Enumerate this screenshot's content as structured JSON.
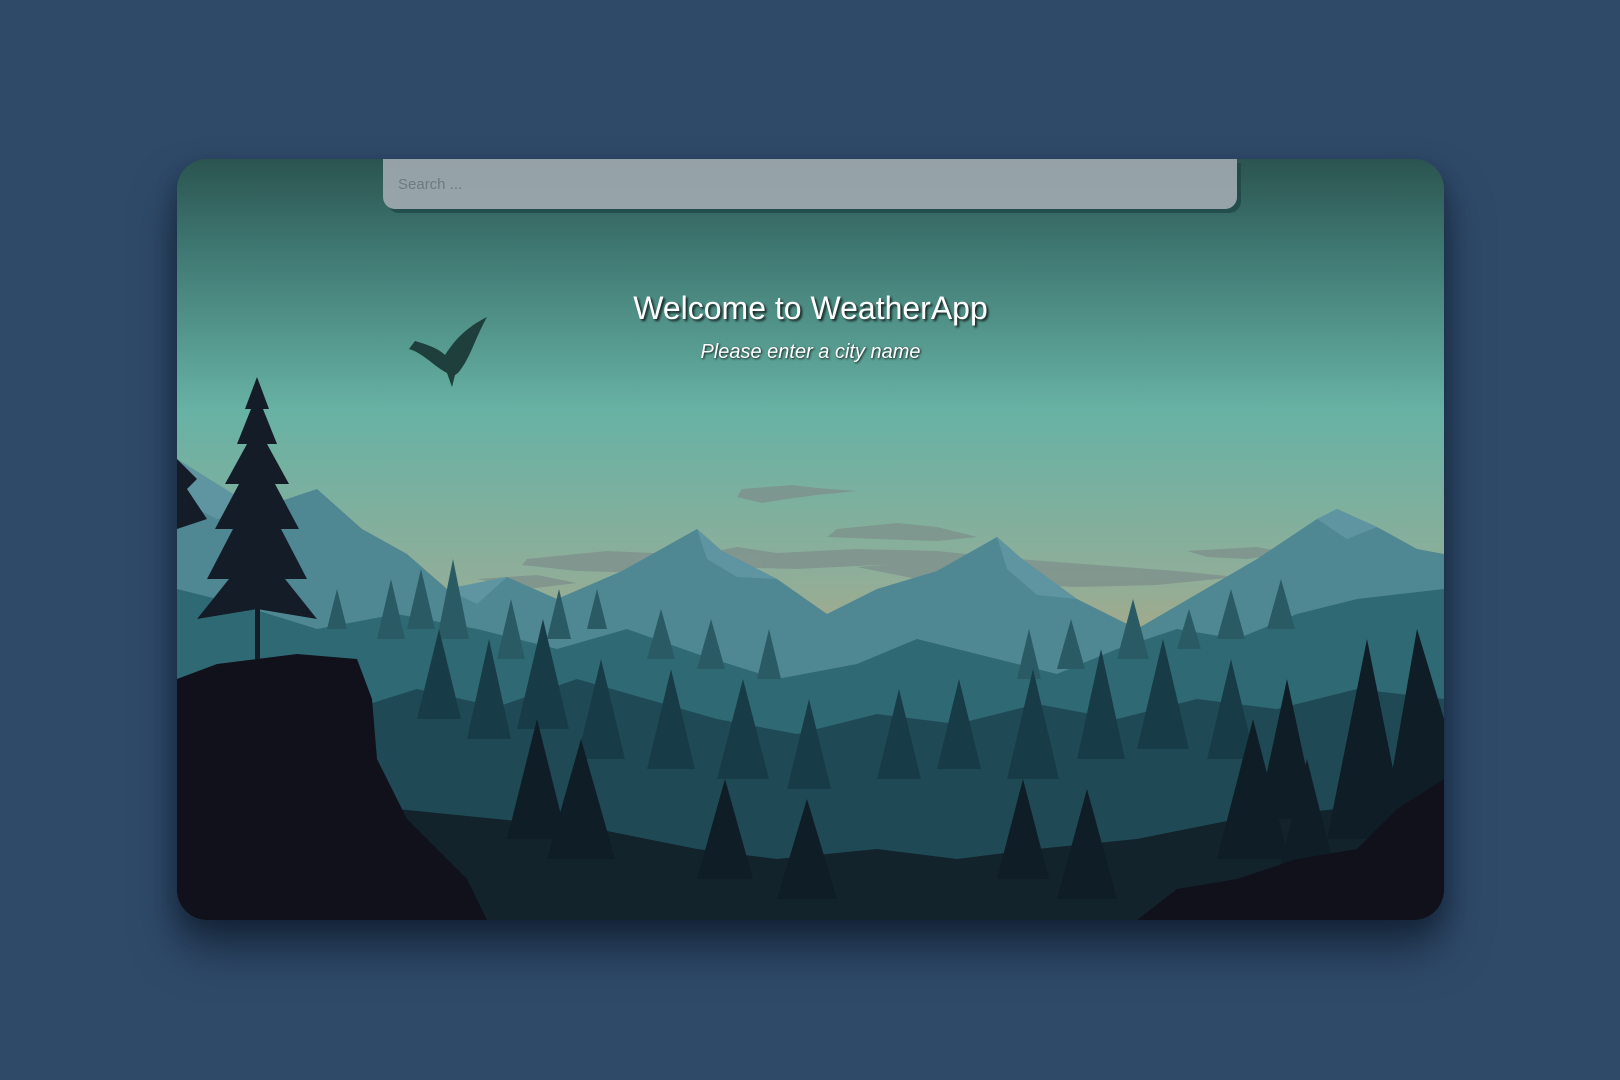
{
  "app": {
    "name": "WeatherApp"
  },
  "search": {
    "placeholder": "Search ...",
    "value": ""
  },
  "welcome": {
    "title": "Welcome to WeatherApp",
    "subtitle": "Please enter a city name"
  },
  "background": {
    "scene": "mountain-forest-landscape",
    "bird_icon": "eagle-icon",
    "colors": {
      "page": "#2f4a69",
      "sky_top": "#2e5a55",
      "sky_mid": "#67b2a4",
      "horizon": "#b5a67c",
      "mountains": "#4e8593",
      "forest_dark": "#102028",
      "rock": "#11111d"
    }
  }
}
